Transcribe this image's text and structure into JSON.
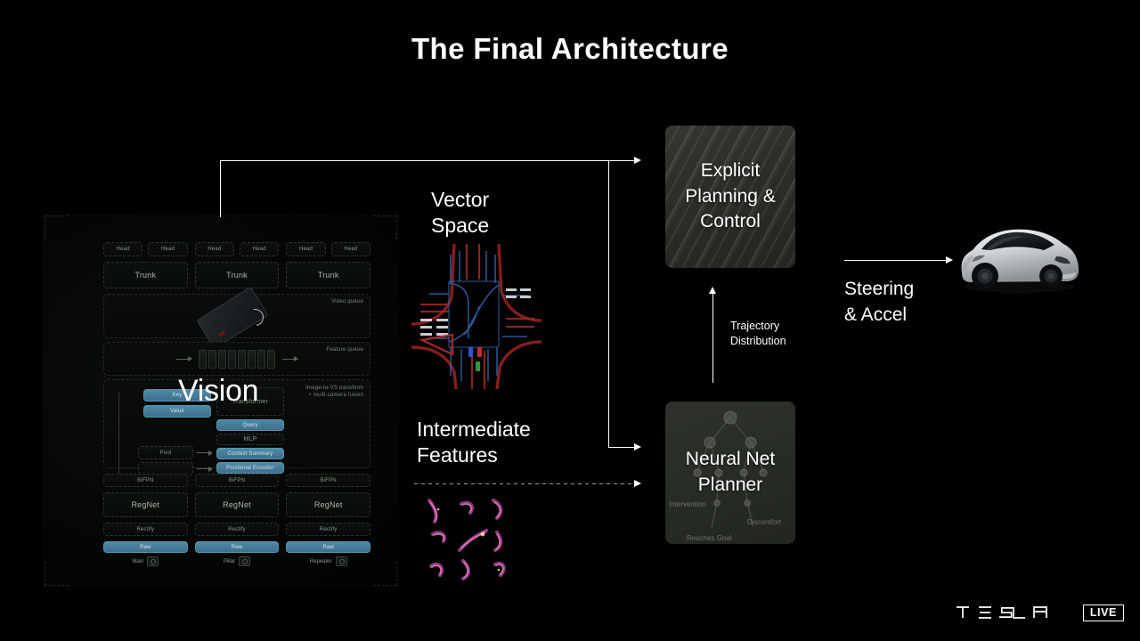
{
  "slide": {
    "title": "The Final Architecture",
    "background_color": "#000000",
    "accent_color": "#ffffff"
  },
  "vision": {
    "word": "Vision",
    "network": {
      "heads": [
        "Head",
        "Head",
        "Head",
        "Head",
        "Head",
        "Head"
      ],
      "trunks": [
        "Trunk",
        "Trunk",
        "Trunk"
      ],
      "video_queue_label": "Video queue",
      "feature_queue_label": "Feature queue",
      "transformer_label_line1": "Image-to-VS transform",
      "transformer_label_line2": "+ multi-camera fusion",
      "transformer_blocks": [
        "Key",
        "Value",
        "Transformer",
        "Query",
        "MLP",
        "Context Summary",
        "Positional Encoder",
        "Pool"
      ],
      "bifpn": [
        "BiFPN",
        "BiFPN",
        "BiFPN"
      ],
      "regnet": [
        "RegNet",
        "RegNet",
        "RegNet"
      ],
      "rectify": [
        "Rectify",
        "Rectify",
        "Rectify"
      ],
      "raw": [
        "Raw",
        "Raw",
        "Raw"
      ],
      "cameras": [
        "Main",
        "Pillar",
        "Repeater"
      ]
    }
  },
  "stages": {
    "vector_space_label": "Vector\nSpace",
    "vector_space_line1": "Vector",
    "vector_space_line2": "Space",
    "intermediate_features_line1": "Intermediate",
    "intermediate_features_line2": "Features",
    "planning_block": "Explicit\nPlanning &\nControl",
    "planning_line1": "Explicit",
    "planning_line2": "Planning &",
    "planning_line3": "Control",
    "planner_block": "Neural Net\nPlanner",
    "planner_line1": "Neural Net",
    "planner_line2": "Planner",
    "planner_cost_labels": [
      "Intervention",
      "Discomfort",
      "Reaches Goal"
    ],
    "trajectory_line1": "Trajectory",
    "trajectory_line2": "Distribution",
    "steering_line1": "Steering",
    "steering_line2": "& Accel"
  },
  "footer": {
    "brand": "TESLA",
    "live_badge": "LIVE"
  }
}
